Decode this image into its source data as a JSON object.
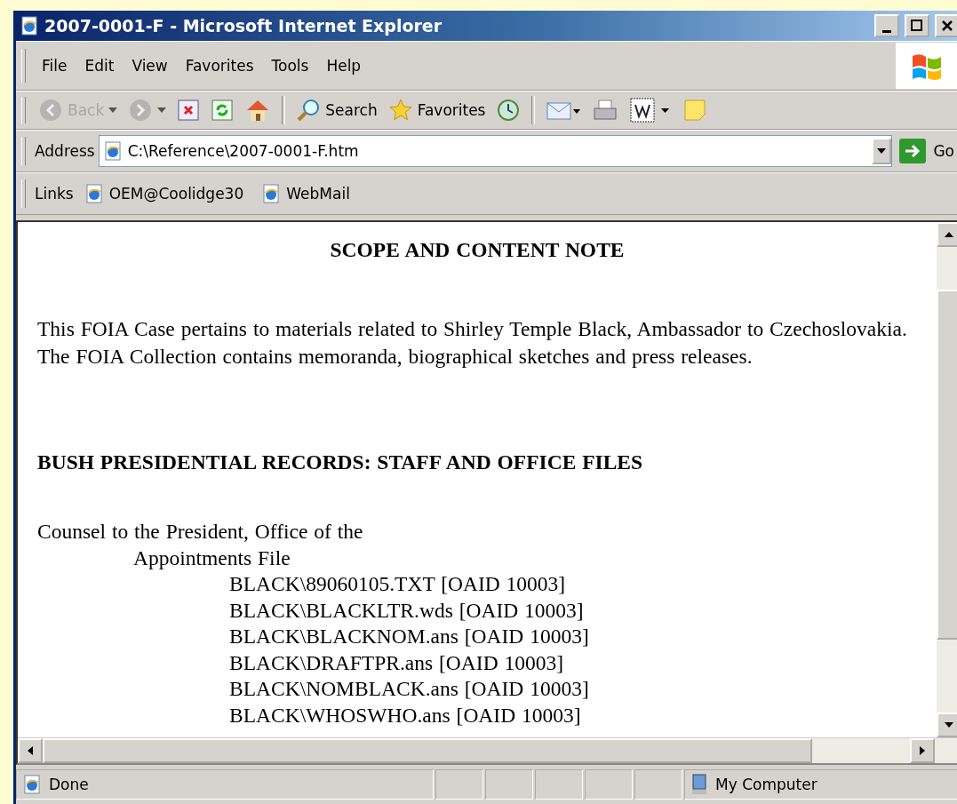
{
  "window": {
    "title": "2007-0001-F - Microsoft Internet Explorer"
  },
  "menu": [
    "File",
    "Edit",
    "View",
    "Favorites",
    "Tools",
    "Help"
  ],
  "toolbar": [
    {
      "kind": "back",
      "label": "Back",
      "disabled": true
    },
    {
      "kind": "forward",
      "disabled": true
    },
    {
      "kind": "stop",
      "disabled": false
    },
    {
      "kind": "refresh",
      "disabled": false
    },
    {
      "kind": "home",
      "disabled": false
    },
    {
      "kind": "search",
      "label": "Search",
      "disabled": false
    },
    {
      "kind": "favorites",
      "label": "Favorites",
      "disabled": false
    },
    {
      "kind": "history",
      "disabled": false
    },
    {
      "kind": "mail",
      "disabled": false
    },
    {
      "kind": "print",
      "disabled": false
    },
    {
      "kind": "word",
      "disabled": false
    },
    {
      "kind": "note",
      "disabled": false
    }
  ],
  "address": {
    "label": "Address",
    "value": "C:\\Reference\\2007-0001-F.htm",
    "go": "Go"
  },
  "links": {
    "label": "Links",
    "items": [
      "OEM@Coolidge30",
      "WebMail"
    ]
  },
  "document": {
    "title": "SCOPE AND CONTENT NOTE",
    "paragraph": "This FOIA Case pertains to materials related to Shirley Temple Black, Ambassador to Czechoslovakia. The FOIA Collection contains memoranda, biographical sketches and press releases.",
    "heading": "BUSH PRESIDENTIAL RECORDS: STAFF AND OFFICE FILES",
    "tree": [
      {
        "text": "Counsel to the President, Office of the",
        "children": [
          {
            "text": "Appointments File",
            "children": [
              {
                "text": "BLACK\\89060105.TXT [OAID 10003]"
              },
              {
                "text": "BLACK\\BLACKLTR.wds [OAID 10003]"
              },
              {
                "text": "BLACK\\BLACKNOM.ans [OAID 10003]"
              },
              {
                "text": "BLACK\\DRAFTPR.ans [OAID 10003]"
              },
              {
                "text": "BLACK\\NOMBLACK.ans [OAID 10003]"
              },
              {
                "text": "BLACK\\WHOSWHO.ans [OAID 10003]"
              }
            ]
          }
        ]
      }
    ]
  },
  "status_bar": {
    "text": "Done",
    "zone": "My Computer"
  }
}
